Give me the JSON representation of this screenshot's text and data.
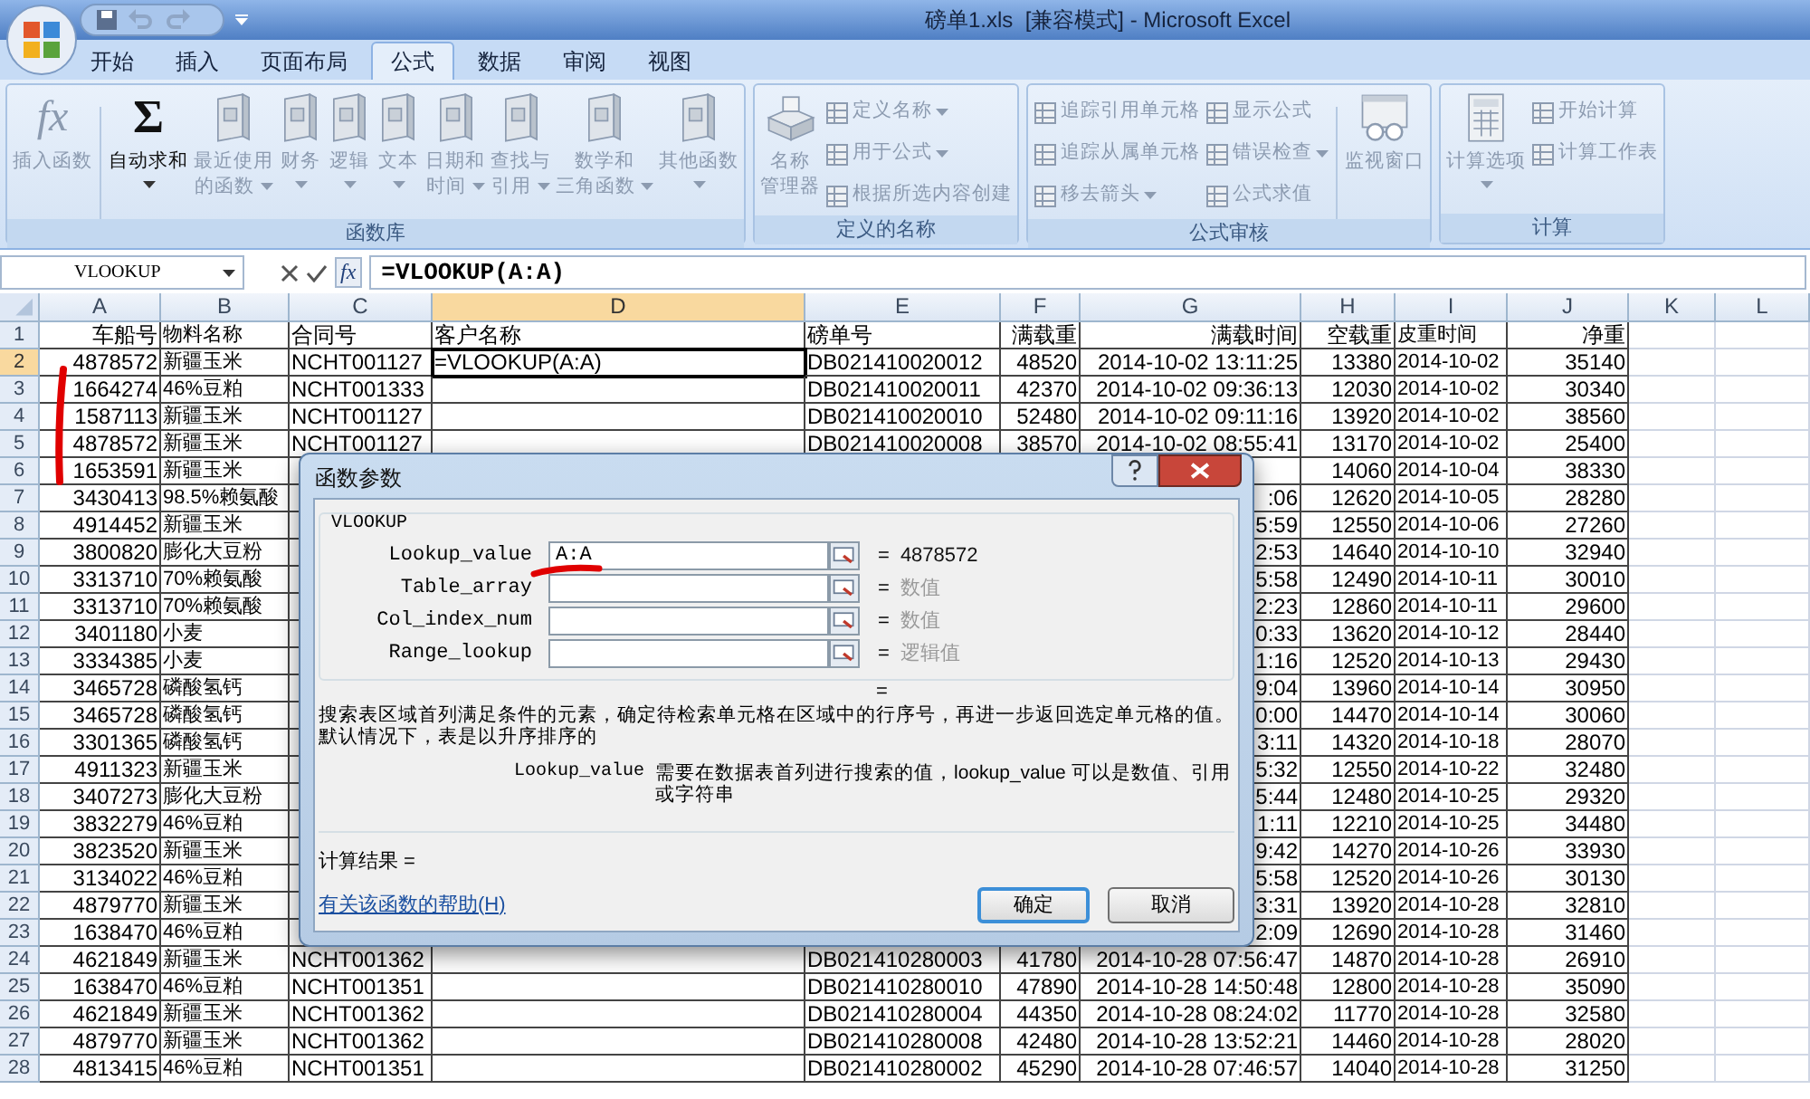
{
  "window": {
    "title": "磅单1.xls  [兼容模式] - Microsoft Excel"
  },
  "tabs": [
    {
      "label": "开始",
      "selected": false
    },
    {
      "label": "插入",
      "selected": false
    },
    {
      "label": "页面布局",
      "selected": false
    },
    {
      "label": "公式",
      "selected": true
    },
    {
      "label": "数据",
      "selected": false
    },
    {
      "label": "审阅",
      "selected": false
    },
    {
      "label": "视图",
      "selected": false
    }
  ],
  "ribbon": {
    "groups": [
      {
        "label": "函数库",
        "items": [
          {
            "kind": "glyph",
            "icon": "fx",
            "lines": [
              "插入函数"
            ],
            "dropdown": false,
            "disabled": true
          },
          {
            "kind": "separator"
          },
          {
            "kind": "glyph",
            "icon": "Σ",
            "lines": [
              "自动求和"
            ],
            "dropdown": true,
            "disabled": false
          },
          {
            "kind": "book",
            "lines": [
              "最近使用",
              "的函数"
            ],
            "dropdown": true,
            "disabled": true
          },
          {
            "kind": "book",
            "lines": [
              "财务"
            ],
            "dropdown": true,
            "disabled": true
          },
          {
            "kind": "book",
            "lines": [
              "逻辑"
            ],
            "dropdown": true,
            "disabled": true
          },
          {
            "kind": "book",
            "lines": [
              "文本"
            ],
            "dropdown": true,
            "disabled": true
          },
          {
            "kind": "book",
            "lines": [
              "日期和",
              "时间"
            ],
            "dropdown": true,
            "disabled": true
          },
          {
            "kind": "book",
            "lines": [
              "查找与",
              "引用"
            ],
            "dropdown": true,
            "disabled": true
          },
          {
            "kind": "book",
            "lines": [
              "数学和",
              "三角函数"
            ],
            "dropdown": true,
            "disabled": true
          },
          {
            "kind": "book",
            "lines": [
              "其他函数"
            ],
            "dropdown": true,
            "disabled": true
          }
        ]
      },
      {
        "label": "定义的名称",
        "items": [
          {
            "kind": "cabinet",
            "lines": [
              "名称",
              "管理器"
            ],
            "dropdown": false,
            "disabled": true
          },
          {
            "kind": "small",
            "label": "定义名称",
            "dropdown": true,
            "disabled": true
          },
          {
            "kind": "small",
            "label": "用于公式",
            "dropdown": true,
            "disabled": true
          },
          {
            "kind": "small",
            "label": "根据所选内容创建",
            "dropdown": false,
            "disabled": true
          }
        ]
      },
      {
        "label": "公式审核",
        "items": [
          {
            "kind": "small",
            "label": "追踪引用单元格",
            "dropdown": false,
            "disabled": true
          },
          {
            "kind": "small",
            "label": "追踪从属单元格",
            "dropdown": false,
            "disabled": true
          },
          {
            "kind": "small",
            "label": "移去箭头",
            "dropdown": true,
            "disabled": true
          },
          {
            "kind": "small",
            "label": "显示公式",
            "dropdown": false,
            "disabled": true
          },
          {
            "kind": "small",
            "label": "错误检查",
            "dropdown": true,
            "disabled": true
          },
          {
            "kind": "small",
            "label": "公式求值",
            "dropdown": false,
            "disabled": true
          },
          {
            "kind": "separator"
          },
          {
            "kind": "watch",
            "lines": [
              "监视窗口"
            ],
            "dropdown": false,
            "disabled": true
          }
        ]
      },
      {
        "label": "计算",
        "items": [
          {
            "kind": "calculator",
            "lines": [
              "计算选项"
            ],
            "dropdown": true,
            "disabled": true
          },
          {
            "kind": "small",
            "label": "开始计算",
            "dropdown": false,
            "disabled": true
          },
          {
            "kind": "small",
            "label": "计算工作表",
            "dropdown": false,
            "disabled": true
          }
        ]
      }
    ]
  },
  "formula_bar": {
    "name_box": "VLOOKUP",
    "fx": "fx",
    "formula": "=VLOOKUP(A:A)"
  },
  "columns": [
    {
      "label": "A",
      "selected": false
    },
    {
      "label": "B",
      "selected": false
    },
    {
      "label": "C",
      "selected": false
    },
    {
      "label": "D",
      "selected": true
    },
    {
      "label": "E",
      "selected": false
    },
    {
      "label": "F",
      "selected": false
    },
    {
      "label": "G",
      "selected": false
    },
    {
      "label": "H",
      "selected": false
    },
    {
      "label": "I",
      "selected": false
    },
    {
      "label": "J",
      "selected": false
    },
    {
      "label": "K",
      "selected": false
    },
    {
      "label": "L",
      "selected": false
    }
  ],
  "rows": [
    {
      "number": "1",
      "selected": false,
      "cells": {
        "A": "车船号",
        "B": "物料名称",
        "C": "合同号",
        "D": "客户名称",
        "E": "磅单号",
        "F": "满载重",
        "G": "满载时间",
        "H": "空载重",
        "I": "皮重时间",
        "J": "净重"
      }
    },
    {
      "number": "2",
      "selected": true,
      "cells": {
        "A": "4878572",
        "B": "新疆玉米",
        "C": "NCHT001127",
        "D": "=VLOOKUP(A:A)",
        "E": "DB021410020012",
        "F": "48520",
        "G": "2014-10-02 13:11:25",
        "H": "13380",
        "I": "2014-10-02",
        "J": "35140"
      }
    },
    {
      "number": "3",
      "selected": false,
      "cells": {
        "A": "1664274",
        "B": "46%豆粕",
        "C": "NCHT001333",
        "E": "DB021410020011",
        "F": "42370",
        "G": "2014-10-02 09:36:13",
        "H": "12030",
        "I": "2014-10-02",
        "J": "30340"
      }
    },
    {
      "number": "4",
      "selected": false,
      "cells": {
        "A": "1587113",
        "B": "新疆玉米",
        "C": "NCHT001127",
        "E": "DB021410020010",
        "F": "52480",
        "G": "2014-10-02 09:11:16",
        "H": "13920",
        "I": "2014-10-02",
        "J": "38560"
      }
    },
    {
      "number": "5",
      "selected": false,
      "cells": {
        "A": "4878572",
        "B": "新疆玉米",
        "C": "NCHT001127",
        "E": "DB021410020008",
        "F": "38570",
        "G": "2014-10-02 08:55:41",
        "H": "13170",
        "I": "2014-10-02",
        "J": "25400"
      }
    },
    {
      "number": "6",
      "selected": false,
      "cells": {
        "A": "1653591",
        "B": "新疆玉米",
        "H": "14060",
        "I": "2014-10-04",
        "J": "38330"
      }
    },
    {
      "number": "7",
      "selected": false,
      "cells": {
        "A": "3430413",
        "B": "98.5%赖氨酸",
        "G": ":06",
        "H": "12620",
        "I": "2014-10-05",
        "J": "28280"
      }
    },
    {
      "number": "8",
      "selected": false,
      "cells": {
        "A": "4914452",
        "B": "新疆玉米",
        "G": "5:59",
        "H": "12550",
        "I": "2014-10-06",
        "J": "27260"
      }
    },
    {
      "number": "9",
      "selected": false,
      "cells": {
        "A": "3800820",
        "B": "膨化大豆粉",
        "G": "2:53",
        "H": "14640",
        "I": "2014-10-10",
        "J": "32940"
      }
    },
    {
      "number": "10",
      "selected": false,
      "cells": {
        "A": "3313710",
        "B": "70%赖氨酸",
        "G": "5:58",
        "H": "12490",
        "I": "2014-10-11",
        "J": "30010"
      }
    },
    {
      "number": "11",
      "selected": false,
      "cells": {
        "A": "3313710",
        "B": "70%赖氨酸",
        "G": "2:23",
        "H": "12860",
        "I": "2014-10-11",
        "J": "29600"
      }
    },
    {
      "number": "12",
      "selected": false,
      "cells": {
        "A": "3401180",
        "B": "小麦",
        "G": "0:33",
        "H": "13620",
        "I": "2014-10-12",
        "J": "28440"
      }
    },
    {
      "number": "13",
      "selected": false,
      "cells": {
        "A": "3334385",
        "B": "小麦",
        "G": "1:16",
        "H": "12520",
        "I": "2014-10-13",
        "J": "29430"
      }
    },
    {
      "number": "14",
      "selected": false,
      "cells": {
        "A": "3465728",
        "B": "磷酸氢钙",
        "G": "9:04",
        "H": "13960",
        "I": "2014-10-14",
        "J": "30950"
      }
    },
    {
      "number": "15",
      "selected": false,
      "cells": {
        "A": "3465728",
        "B": "磷酸氢钙",
        "G": "0:00",
        "H": "14470",
        "I": "2014-10-14",
        "J": "30060"
      }
    },
    {
      "number": "16",
      "selected": false,
      "cells": {
        "A": "3301365",
        "B": "磷酸氢钙",
        "G": "3:11",
        "H": "14320",
        "I": "2014-10-18",
        "J": "28070"
      }
    },
    {
      "number": "17",
      "selected": false,
      "cells": {
        "A": "4911323",
        "B": "新疆玉米",
        "G": "5:32",
        "H": "12550",
        "I": "2014-10-22",
        "J": "32480"
      }
    },
    {
      "number": "18",
      "selected": false,
      "cells": {
        "A": "3407273",
        "B": "膨化大豆粉",
        "G": "5:44",
        "H": "12480",
        "I": "2014-10-25",
        "J": "29320"
      }
    },
    {
      "number": "19",
      "selected": false,
      "cells": {
        "A": "3832279",
        "B": "46%豆粕",
        "G": "1:11",
        "H": "12210",
        "I": "2014-10-25",
        "J": "34480"
      }
    },
    {
      "number": "20",
      "selected": false,
      "cells": {
        "A": "3823520",
        "B": "新疆玉米",
        "G": "9:42",
        "H": "14270",
        "I": "2014-10-26",
        "J": "33930"
      }
    },
    {
      "number": "21",
      "selected": false,
      "cells": {
        "A": "3134022",
        "B": "46%豆粕",
        "G": "5:58",
        "H": "12520",
        "I": "2014-10-26",
        "J": "30130"
      }
    },
    {
      "number": "22",
      "selected": false,
      "cells": {
        "A": "4879770",
        "B": "新疆玉米",
        "G": "3:31",
        "H": "13920",
        "I": "2014-10-28",
        "J": "32810"
      }
    },
    {
      "number": "23",
      "selected": false,
      "cells": {
        "A": "1638470",
        "B": "46%豆粕",
        "G": "2:09",
        "H": "12690",
        "I": "2014-10-28",
        "J": "31460"
      }
    },
    {
      "number": "24",
      "selected": false,
      "cells": {
        "A": "4621849",
        "B": "新疆玉米",
        "C": "NCHT001362",
        "E": "DB021410280003",
        "F": "41780",
        "G": "2014-10-28 07:56:47",
        "H": "14870",
        "I": "2014-10-28",
        "J": "26910"
      }
    },
    {
      "number": "25",
      "selected": false,
      "cells": {
        "A": "1638470",
        "B": "46%豆粕",
        "C": "NCHT001351",
        "E": "DB021410280010",
        "F": "47890",
        "G": "2014-10-28 14:50:48",
        "H": "12800",
        "I": "2014-10-28",
        "J": "35090"
      }
    },
    {
      "number": "26",
      "selected": false,
      "cells": {
        "A": "4621849",
        "B": "新疆玉米",
        "C": "NCHT001362",
        "E": "DB021410280004",
        "F": "44350",
        "G": "2014-10-28 08:24:02",
        "H": "11770",
        "I": "2014-10-28",
        "J": "32580"
      }
    },
    {
      "number": "27",
      "selected": false,
      "cells": {
        "A": "4879770",
        "B": "新疆玉米",
        "C": "NCHT001362",
        "E": "DB021410280008",
        "F": "42480",
        "G": "2014-10-28 13:52:21",
        "H": "14460",
        "I": "2014-10-28",
        "J": "28020"
      }
    },
    {
      "number": "28",
      "selected": false,
      "cells": {
        "A": "4813415",
        "B": "46%豆粕",
        "C": "NCHT001351",
        "E": "DB021410280002",
        "F": "45290",
        "G": "2014-10-28 07:46:57",
        "H": "14040",
        "I": "2014-10-28",
        "J": "31250"
      }
    }
  ],
  "dialog": {
    "title": "函数参数",
    "function": "VLOOKUP",
    "arguments": [
      {
        "label": "Lookup_value",
        "value": "A:A",
        "equals": "=",
        "result": "4878572",
        "muted": false
      },
      {
        "label": "Table_array",
        "equals": "=",
        "result": "数值",
        "muted": true
      },
      {
        "label": "Col_index_num",
        "equals": "=",
        "result": "数值",
        "muted": true
      },
      {
        "label": "Range_lookup",
        "equals": "=",
        "result": "逻辑值",
        "muted": true
      }
    ],
    "overall_result": "=",
    "description": "搜索表区域首列满足条件的元素，确定待检索单元格在区域中的行序号，再进一步返回选定单元格的值。默认情况下，表是以升序排序的",
    "param_name": "Lookup_value",
    "param_description": "需要在数据表首列进行搜索的值，lookup_value 可以是数值、引用或字符串",
    "result_label": "计算结果 =",
    "help_link": "有关该函数的帮助(H)",
    "buttons": [
      {
        "label": "确定",
        "default": true
      },
      {
        "label": "取消",
        "default": false
      }
    ]
  }
}
